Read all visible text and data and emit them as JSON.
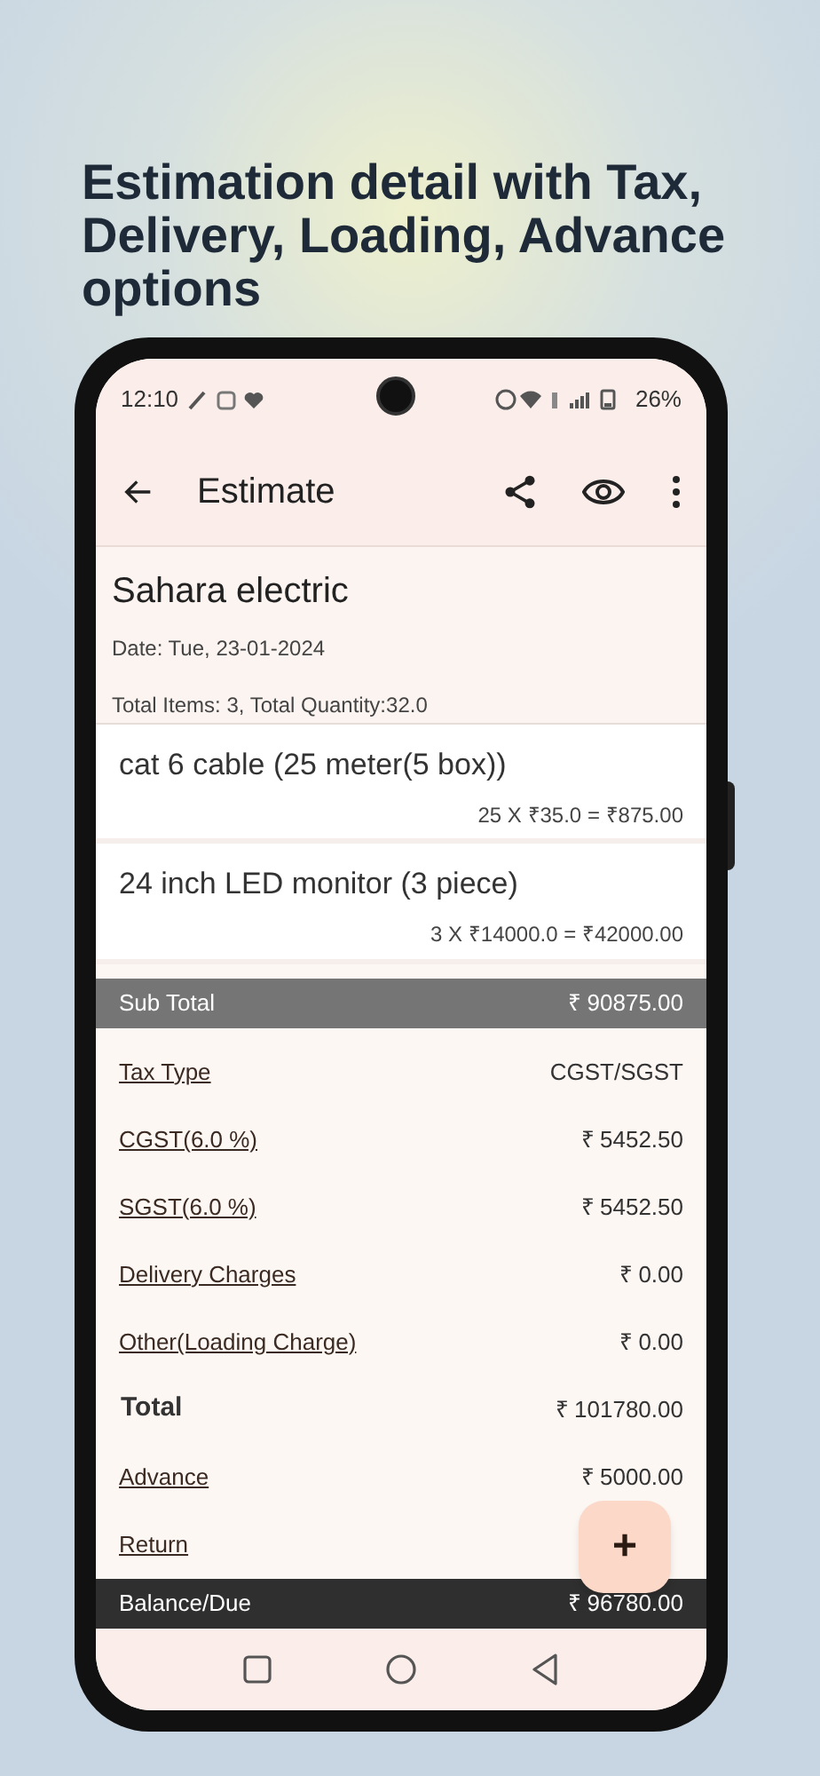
{
  "headline": "Estimation detail with Tax, Delivery, Loading, Advance options",
  "status_bar": {
    "time": "12:10",
    "battery": "26%"
  },
  "app_bar": {
    "title": "Estimate"
  },
  "header": {
    "customer": "Sahara electric",
    "date": "Date: Tue, 23-01-2024",
    "totals": "Total Items: 3, Total Quantity:32.0"
  },
  "items": [
    {
      "name": "cat 6 cable (25 meter(5 box))",
      "calc": "25 X ₹35.0 = ₹875.00"
    },
    {
      "name": "24 inch LED monitor (3 piece)",
      "calc": "3 X ₹14000.0 = ₹42000.00"
    }
  ],
  "summary": [
    {
      "kind": "header",
      "label": "Sub Total",
      "value": "₹ 90875.00"
    },
    {
      "kind": "link",
      "label": "Tax Type",
      "value": "CGST/SGST"
    },
    {
      "kind": "link",
      "label": "CGST(6.0 %)",
      "value": "₹ 5452.50"
    },
    {
      "kind": "link",
      "label": "SGST(6.0 %)",
      "value": "₹ 5452.50"
    },
    {
      "kind": "link",
      "label": "Delivery Charges",
      "value": "₹ 0.00"
    },
    {
      "kind": "link",
      "label": "Other(Loading Charge)",
      "value": "₹ 0.00"
    },
    {
      "kind": "total",
      "label": "Total",
      "value": "₹ 101780.00"
    },
    {
      "kind": "link",
      "label": "Advance",
      "value": "₹ 5000.00"
    },
    {
      "kind": "link",
      "label": "Return"
    },
    {
      "kind": "footer",
      "label": "Balance/Due",
      "value": "₹ 96780.00"
    }
  ],
  "fab": {
    "label": "+"
  }
}
